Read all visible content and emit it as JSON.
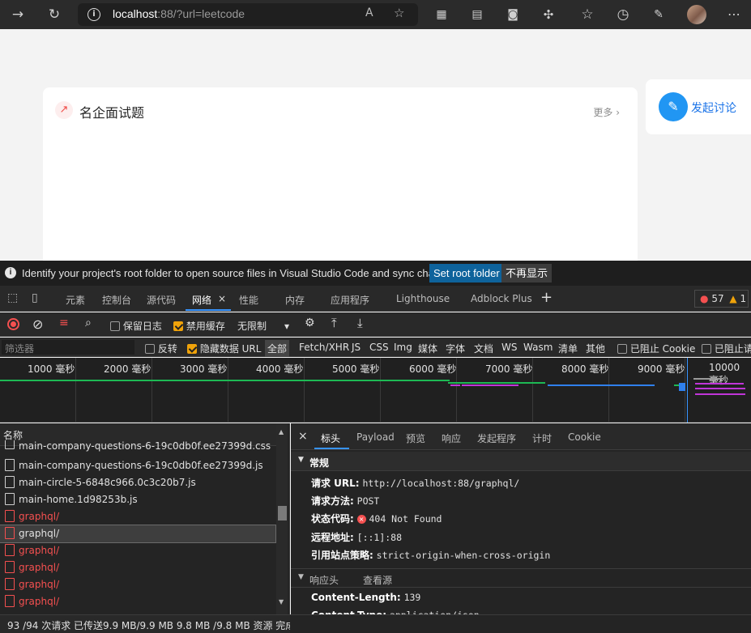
{
  "browser": {
    "url_host": "localhost",
    "url_rest": ":88/?url=leetcode",
    "avatar": "avatar",
    "more": "⋯"
  },
  "page": {
    "card_title": "名企面试题",
    "card_more": "更多",
    "discuss_label": "发起讨论"
  },
  "infobar": {
    "message": "Identify your project's root folder to open source files in Visual Studio Code and sync changes.",
    "set_root": "Set root folder",
    "dismiss": "不再显示"
  },
  "devtools": {
    "tabs": [
      "元素",
      "控制台",
      "源代码",
      "网络",
      "性能",
      "内存",
      "应用程序",
      "Lighthouse",
      "Adblock Plus"
    ],
    "active_tab": "网络",
    "errors": "57",
    "warnings": "1"
  },
  "network": {
    "preserve_log": "保留日志",
    "disable_cache": "禁用缓存",
    "throttle": "无限制",
    "filter_placeholder": "筛选器",
    "invert": "反转",
    "hide_data_url": "隐藏数据 URL",
    "types": [
      "全部",
      "Fetch/XHR",
      "JS",
      "CSS",
      "Img",
      "媒体",
      "字体",
      "文档",
      "WS",
      "Wasm",
      "清单",
      "其他"
    ],
    "blocked_cookies": "已阻止 Cookie",
    "blocked_requests": "已阻止请"
  },
  "timeline": {
    "ticks": [
      "1000 毫秒",
      "2000 毫秒",
      "3000 毫秒",
      "4000 毫秒",
      "5000 毫秒",
      "6000 毫秒",
      "7000 毫秒",
      "8000 毫秒",
      "9000 毫秒",
      "10000 毫秒"
    ]
  },
  "requests": {
    "header": "名称",
    "rows": [
      {
        "name": "main-company-questions-6-19c0db0f.ee27399d.css",
        "error": false,
        "selected": false
      },
      {
        "name": "main-company-questions-6-19c0db0f.ee27399d.js",
        "error": false,
        "selected": false
      },
      {
        "name": "main-circle-5-6848c966.0c3c20b7.js",
        "error": false,
        "selected": false
      },
      {
        "name": "main-home.1d98253b.js",
        "error": false,
        "selected": false
      },
      {
        "name": "graphql/",
        "error": true,
        "selected": false
      },
      {
        "name": "graphql/",
        "error": false,
        "selected": true
      },
      {
        "name": "graphql/",
        "error": true,
        "selected": false
      },
      {
        "name": "graphql/",
        "error": true,
        "selected": false
      },
      {
        "name": "graphql/",
        "error": true,
        "selected": false
      },
      {
        "name": "graphql/",
        "error": true,
        "selected": false
      }
    ]
  },
  "detail": {
    "tabs": [
      "标头",
      "Payload",
      "预览",
      "响应",
      "发起程序",
      "计时",
      "Cookie"
    ],
    "active": "标头",
    "general_title": "常规",
    "general": [
      {
        "k": "请求 URL:",
        "v": "http://localhost:88/graphql/"
      },
      {
        "k": "请求方法:",
        "v": "POST"
      },
      {
        "k": "状态代码:",
        "v": "404 Not Found"
      },
      {
        "k": "远程地址:",
        "v": "[::1]:88"
      },
      {
        "k": "引用站点策略:",
        "v": "strict-origin-when-cross-origin"
      }
    ],
    "response_title": "响应头",
    "view_source": "查看源",
    "response": [
      {
        "k": "Content-Length:",
        "v": "139"
      },
      {
        "k": "Content-Type:",
        "v": "application/json"
      }
    ]
  },
  "status": {
    "text": "93 /94 次请求  已传送9.9 MB/9.9 MB  9.8 MB /9.8 MB 资源  完成:"
  },
  "colors": {
    "accent": "#3794ff",
    "error": "#f45050",
    "warning": "#f0a30a"
  }
}
